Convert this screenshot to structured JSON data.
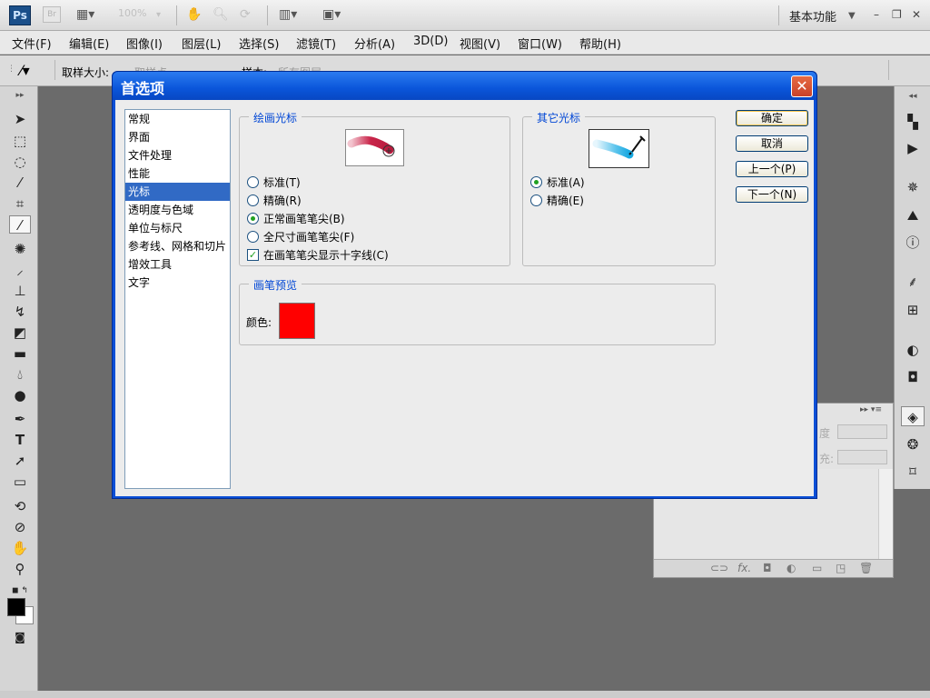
{
  "appbar": {
    "logo": "Ps",
    "bridge": "Br",
    "zoom": "100%",
    "workspace": "基本功能",
    "icons": [
      "film-icon",
      "hand-icon",
      "zoom-icon",
      "rotate-icon",
      "layout-icon",
      "screen-mode-icon"
    ]
  },
  "menubar": {
    "items": [
      "文件(F)",
      "编辑(E)",
      "图像(I)",
      "图层(L)",
      "选择(S)",
      "滤镜(T)",
      "分析(A)",
      "3D(D)",
      "视图(V)",
      "窗口(W)",
      "帮助(H)"
    ]
  },
  "optbar": {
    "sample_size_label": "取样大小:",
    "sample_value": "取样点",
    "sample_label2": "样本:",
    "sample_value2": "所有图层"
  },
  "dialog": {
    "title": "首选项",
    "categories": [
      "常规",
      "界面",
      "文件处理",
      "性能",
      "光标",
      "透明度与色域",
      "单位与标尺",
      "参考线、网格和切片",
      "增效工具",
      "文字"
    ],
    "selected_category": "光标",
    "painting_cursors": {
      "legend": "绘画光标",
      "options": [
        "标准(T)",
        "精确(R)",
        "正常画笔笔尖(B)",
        "全尺寸画笔笔尖(F)"
      ],
      "selected": "正常画笔笔尖(B)",
      "checkbox": "在画笔笔尖显示十字线(C)",
      "checkbox_checked": true
    },
    "other_cursors": {
      "legend": "其它光标",
      "options": [
        "标准(A)",
        "精确(E)"
      ],
      "selected": "标准(A)"
    },
    "brush_preview": {
      "legend": "画笔预览",
      "color_label": "颜色:",
      "color": "#ff0000"
    },
    "buttons": {
      "ok": "确定",
      "cancel": "取消",
      "prev": "上一个(P)",
      "next": "下一个(N)"
    }
  },
  "layers_panel": {
    "label1": "度",
    "label2": "充:",
    "footer_icons": [
      "link-icon",
      "fx-icon",
      "mask-icon",
      "adjustment-icon",
      "group-icon",
      "new-layer-icon",
      "trash-icon"
    ]
  }
}
